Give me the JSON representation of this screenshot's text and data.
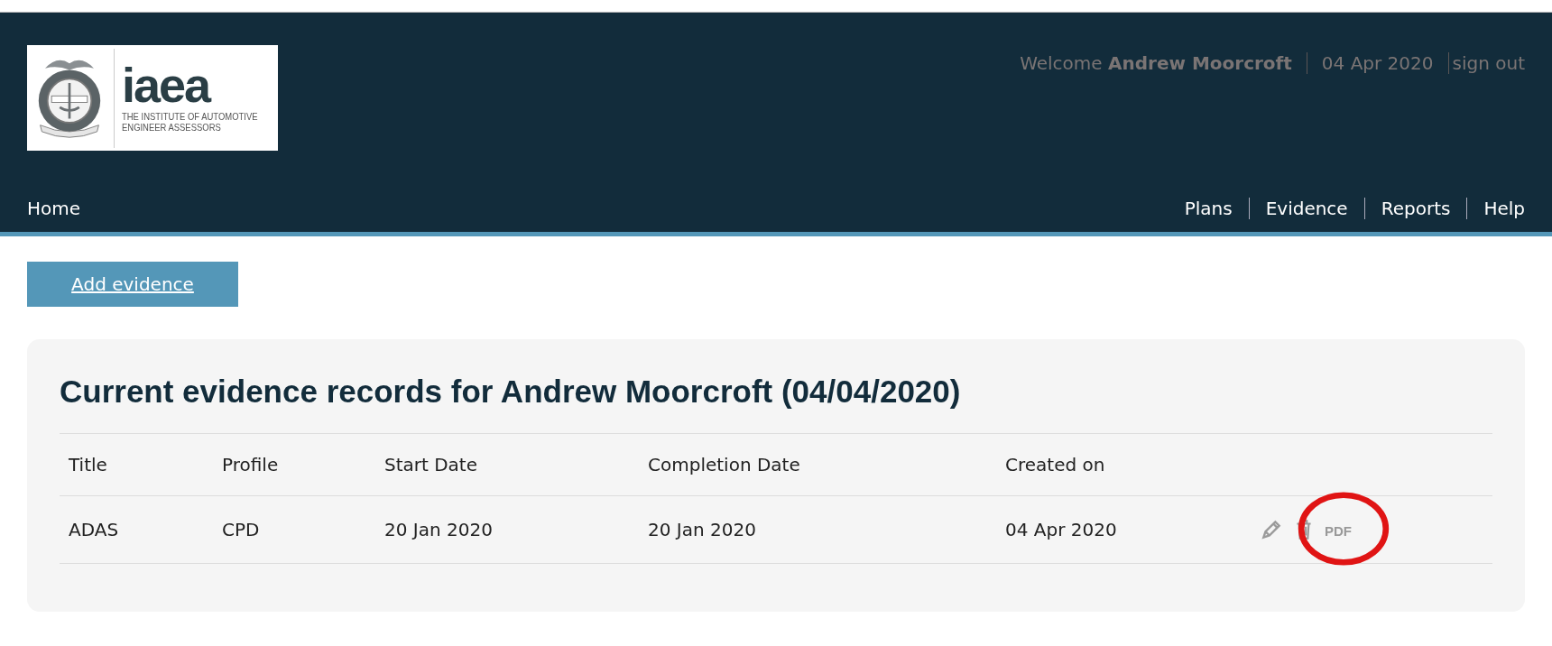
{
  "header": {
    "logo": {
      "wordmark": "iaea",
      "tagline_lines": [
        "THE INSTITUTE OF AUTOMOTIVE",
        "ENGINEER ASSESSORS"
      ]
    },
    "user_bar": {
      "welcome": "Welcome",
      "user_name": "Andrew Moorcroft",
      "date": "04 Apr 2020",
      "sign_out": "sign out"
    },
    "nav_left": [
      {
        "label": "Home"
      }
    ],
    "nav_right": [
      {
        "label": "Plans"
      },
      {
        "label": "Evidence"
      },
      {
        "label": "Reports"
      },
      {
        "label": "Help"
      }
    ]
  },
  "add_button": "Add evidence",
  "panel": {
    "title": "Current evidence records for Andrew Moorcroft (04/04/2020)",
    "columns": [
      "Title",
      "Profile",
      "Start Date",
      "Completion Date",
      "Created on"
    ],
    "rows": [
      {
        "cells": [
          "ADAS",
          "CPD",
          "20 Jan 2020",
          "20 Jan 2020",
          "04 Apr 2020"
        ],
        "pdf": "PDF",
        "highlighted": true
      }
    ]
  }
}
